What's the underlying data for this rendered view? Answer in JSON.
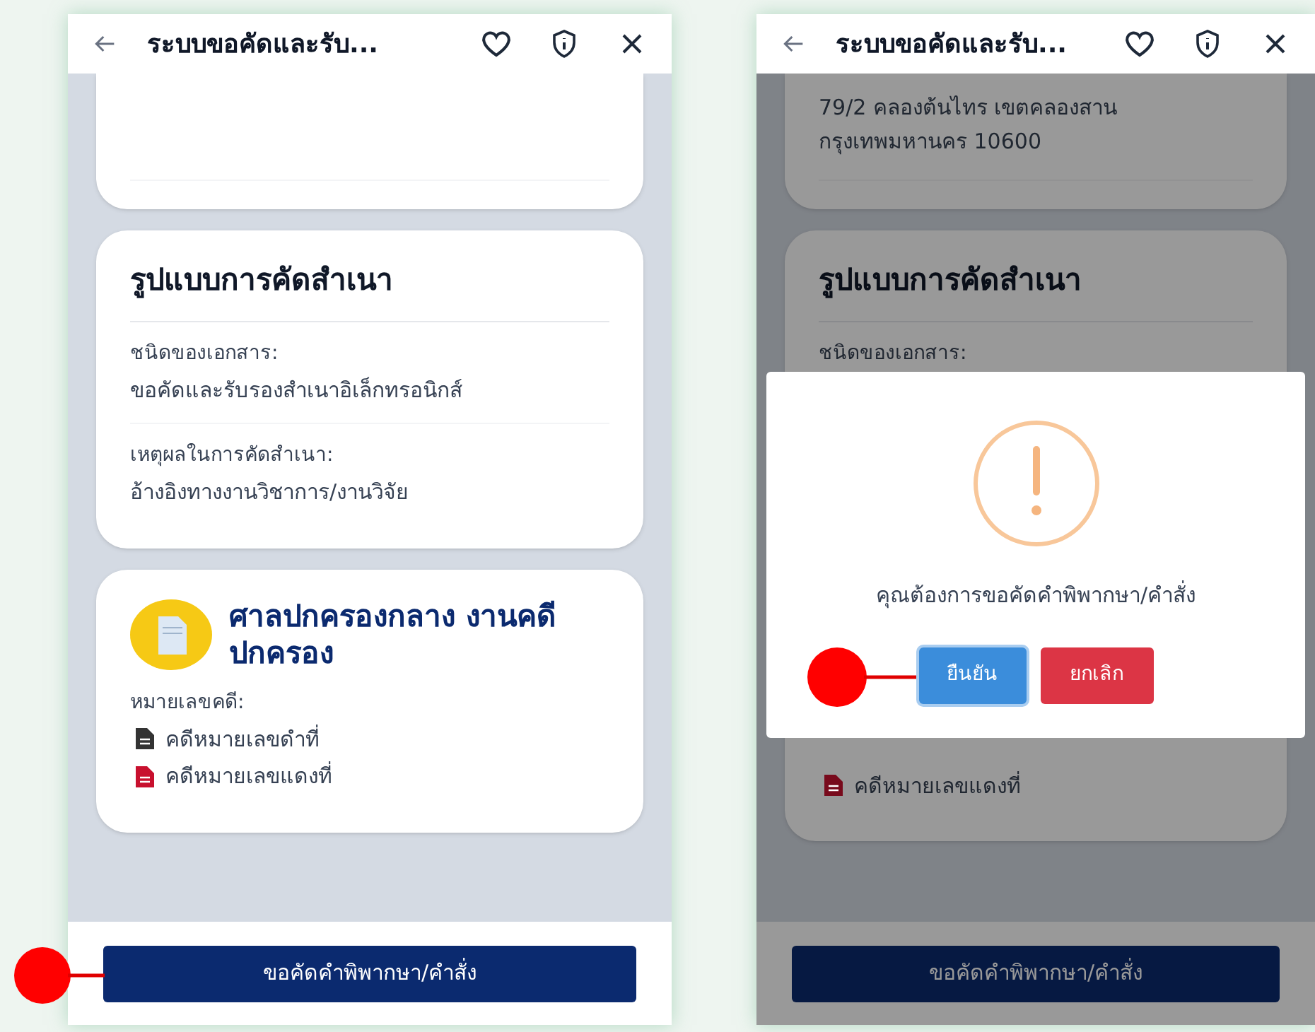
{
  "screens": [
    {
      "header": {
        "title": "ระบบขอคัดและรับ..."
      },
      "dimmed": false,
      "form_card": {
        "heading": "รูปแบบการคัดสำเนา",
        "fields": [
          {
            "label": "ชนิดของเอกสาร:",
            "value": "ขอคัดและรับรองสำเนาอิเล็กทรอนิกส์"
          },
          {
            "label": "เหตุผลในการคัดสำเนา:",
            "value": "อ้างอิงทางงานวิชาการ/งานวิจัย"
          }
        ]
      },
      "court_card": {
        "title": "ศาลปกครองกลาง งานคดีปกครอง",
        "case_label": "หมายเลขคดี:",
        "cases": [
          {
            "text": "คดีหมายเลขดำที่",
            "color": "#333333"
          },
          {
            "text": "คดีหมายเลขแดงที่",
            "color": "#c8102e"
          }
        ]
      },
      "submit_button": "ขอคัดคำพิพากษา/คำสั่ง"
    },
    {
      "header": {
        "title": "ระบบขอคัดและรับ..."
      },
      "dimmed": true,
      "address_card": {
        "lines": [
          "79/2 คลองต้นไทร เขตคลองสาน",
          "กรุงเทพมหานคร 10600"
        ]
      },
      "form_card": {
        "heading": "รูปแบบการคัดสำเนา",
        "fields": [
          {
            "label": "ชนิดของเอกสาร:"
          }
        ]
      },
      "court_card": {
        "cases": [
          {
            "text": "คดีหมายเลขแดงที่",
            "color": "#780a1c"
          }
        ]
      },
      "submit_button": "ขอคัดคำพิพากษา/คำสั่ง",
      "dialog": {
        "message": "คุณต้องการขอคัดคำพิพากษา/คำสั่ง",
        "confirm_button": "ยืนยัน",
        "cancel_button": "ยกเลิก"
      }
    }
  ]
}
